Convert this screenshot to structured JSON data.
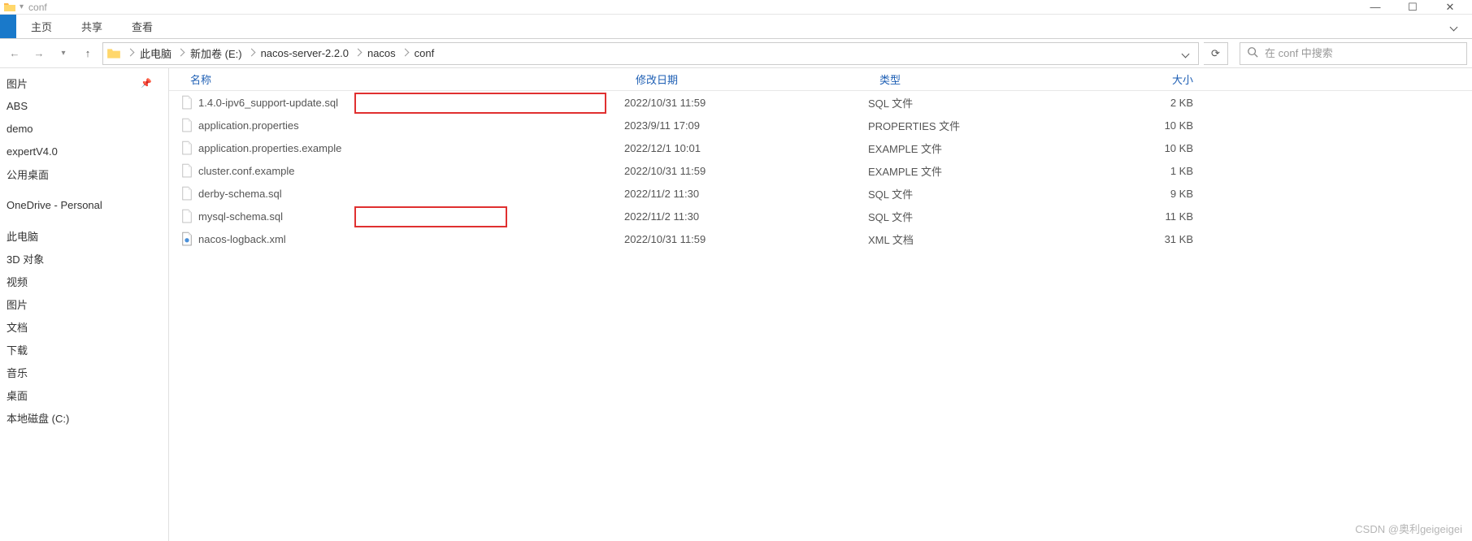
{
  "window": {
    "title": "conf",
    "controls": {
      "minimize": "—",
      "maximize": "☐",
      "close": "✕"
    }
  },
  "ribbon": {
    "tabs": [
      "主页",
      "共享",
      "查看"
    ]
  },
  "nav": {
    "breadcrumbs": [
      "此电脑",
      "新加卷 (E:)",
      "nacos-server-2.2.0",
      "nacos",
      "conf"
    ],
    "search_placeholder": "在 conf 中搜索"
  },
  "sidebar": {
    "items": [
      {
        "label": "图片",
        "pinned": true
      },
      {
        "label": "ABS"
      },
      {
        "label": "demo"
      },
      {
        "label": "expertV4.0"
      },
      {
        "label": "公用桌面"
      },
      {
        "label": ""
      },
      {
        "label": "OneDrive - Personal"
      },
      {
        "label": ""
      },
      {
        "label": "此电脑"
      },
      {
        "label": "3D 对象"
      },
      {
        "label": "视频"
      },
      {
        "label": "图片"
      },
      {
        "label": "文档"
      },
      {
        "label": "下载"
      },
      {
        "label": "音乐"
      },
      {
        "label": "桌面"
      },
      {
        "label": "本地磁盘 (C:)"
      }
    ]
  },
  "columns": {
    "name": "名称",
    "date": "修改日期",
    "type": "类型",
    "size": "大小"
  },
  "files": [
    {
      "name": "1.4.0-ipv6_support-update.sql",
      "date": "2022/10/31 11:59",
      "type": "SQL 文件",
      "size": "2 KB",
      "icon": "file"
    },
    {
      "name": "application.properties",
      "date": "2023/9/11 17:09",
      "type": "PROPERTIES 文件",
      "size": "10 KB",
      "icon": "file"
    },
    {
      "name": "application.properties.example",
      "date": "2022/12/1 10:01",
      "type": "EXAMPLE 文件",
      "size": "10 KB",
      "icon": "file"
    },
    {
      "name": "cluster.conf.example",
      "date": "2022/10/31 11:59",
      "type": "EXAMPLE 文件",
      "size": "1 KB",
      "icon": "file"
    },
    {
      "name": "derby-schema.sql",
      "date": "2022/11/2 11:30",
      "type": "SQL 文件",
      "size": "9 KB",
      "icon": "file"
    },
    {
      "name": "mysql-schema.sql",
      "date": "2022/11/2 11:30",
      "type": "SQL 文件",
      "size": "11 KB",
      "icon": "file"
    },
    {
      "name": "nacos-logback.xml",
      "date": "2022/10/31 11:59",
      "type": "XML 文档",
      "size": "31 KB",
      "icon": "xml"
    }
  ],
  "watermark": "CSDN @奥利geigeigei"
}
